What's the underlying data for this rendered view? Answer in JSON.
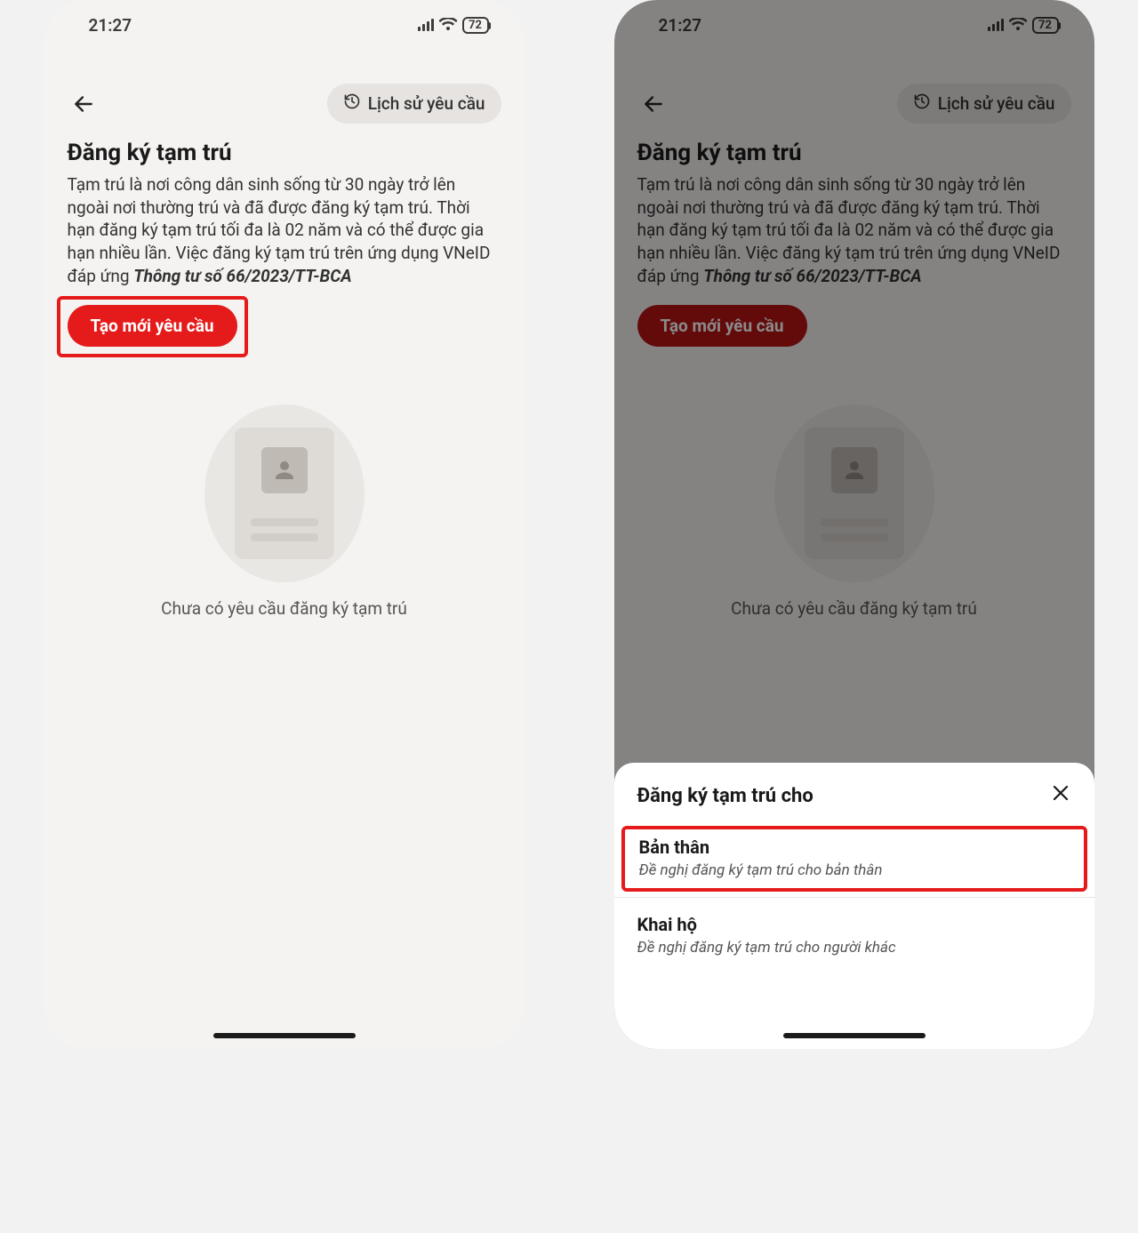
{
  "status": {
    "time": "21:27",
    "battery": "72"
  },
  "header": {
    "history_btn": "Lịch sử yêu cầu"
  },
  "page": {
    "title": "Đăng ký tạm trú",
    "desc_pre": "Tạm trú là nơi công dân sinh sống từ 30 ngày trở lên ngoài nơi thường trú và đã được đăng ký tạm trú. Thời hạn đăng ký tạm trú tối đa là 02 năm và có thể được gia hạn nhiều lần. Việc đăng ký tạm trú trên ứng dụng VNeID đáp ứng ",
    "desc_bold": "Thông tư số 66/2023/TT-BCA",
    "create_btn": "Tạo mới yêu cầu",
    "empty": "Chưa có yêu cầu đăng ký tạm trú"
  },
  "sheet": {
    "title": "Đăng ký tạm trú cho",
    "options": [
      {
        "title": "Bản thân",
        "sub": "Đề nghị đăng ký tạm trú cho bản thân"
      },
      {
        "title": "Khai hộ",
        "sub": "Đề nghị đăng ký tạm trú cho người khác"
      }
    ]
  }
}
